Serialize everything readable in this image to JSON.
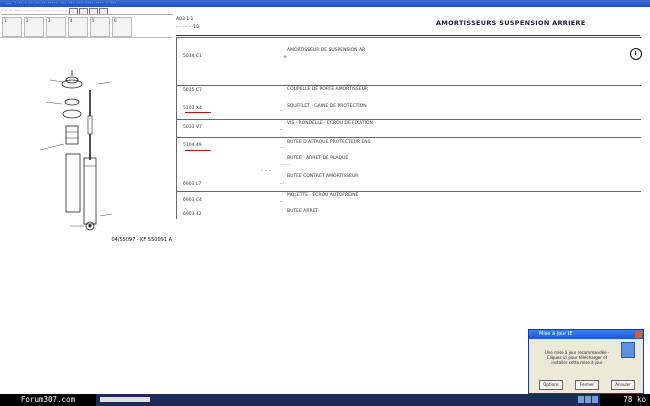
{
  "window": {
    "title": "... · ·· · ·· ·· ·· ····· ··· ··· ··· ···· ···· · ···"
  },
  "left_panel": {
    "address": "·· ·· ··· ······· ···· ·· ·········· ·· ···· ··· ···",
    "thumbnails": [
      "1",
      "2",
      "3",
      "4",
      "5",
      "6"
    ],
    "drawing_ref": "04/55097 · KF 550091 A"
  },
  "main_header": {
    "code1": "A03·1·1",
    "code2": "·· · ··· · ·10",
    "title": "AMORTISSEURS SUSPENSION ARRIERE"
  },
  "rows": [
    {
      "idx": "",
      "code": "5034 C1",
      "desc": "AMORTISSEUR DE SUSPENSION AR",
      "qty": "· ·x·"
    },
    {
      "idx": "",
      "code": "5035 C7",
      "desc": "COUPELLE DE PORTE AMORTISSEUR",
      "qty": "··"
    },
    {
      "idx": "",
      "code": "5103 X4",
      "desc": "SOUFFLET · GAINE DE PROTECTION",
      "qty": "··"
    },
    {
      "idx": "",
      "code": "5033 V7",
      "desc": "VIS · RONDELLE · ECROU DE FIXATION",
      "qty": "··"
    },
    {
      "idx": "",
      "code": "5104 49",
      "desc": "BUTEE D'ATTAQUE PROTECTEUR ENS",
      "qty": "· ··"
    },
    {
      "idx": "",
      "code": "",
      "desc": "BUTEE · ARRET DE PLAQUE",
      "qty": "··· ·· ·"
    },
    {
      "idx": "",
      "code": "6903 L7",
      "desc": "BUTEE CONTACT AMORTISSEUR",
      "qty": "··· ·"
    },
    {
      "idx": "",
      "code": "6903 C4",
      "desc": "MOLETTE · ECROU AUTOFREINE",
      "qty": "··"
    },
    {
      "idx": "",
      "code": "6903 42",
      "desc": "BUTEE ARRET",
      "qty": "··"
    }
  ],
  "side_note": "·· ·· ··",
  "taskbar": {
    "site": "Forum307.com",
    "size": "78 ko"
  },
  "popup": {
    "title": "Mise à jour IE",
    "body": "Une mise à jour recommandée · Cliquez ici pour télécharger et installer cette mise à jour",
    "buttons": [
      "Options",
      "Fermer",
      "Annuler"
    ]
  },
  "colors": {
    "titlebar": "#1f52c8",
    "underline": "#c01010",
    "taskbar": "#1c2a5a"
  }
}
